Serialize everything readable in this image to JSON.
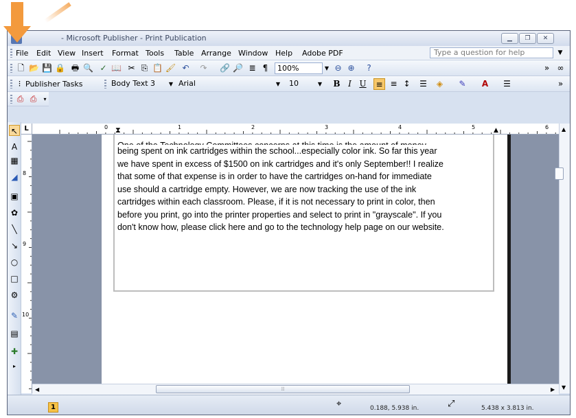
{
  "window": {
    "title": "- Microsoft Publisher - Print Publication",
    "controls": [
      "minimize",
      "restore",
      "close"
    ]
  },
  "menubar": {
    "items": [
      {
        "label": "File"
      },
      {
        "label": "Edit"
      },
      {
        "label": "View"
      },
      {
        "label": "Insert"
      },
      {
        "label": "Format"
      },
      {
        "label": "Tools"
      },
      {
        "label": "Table"
      },
      {
        "label": "Arrange"
      },
      {
        "label": "Window"
      },
      {
        "label": "Help"
      },
      {
        "label": "Adobe PDF"
      }
    ],
    "ask_placeholder": "Type a question for help"
  },
  "standard_toolbar": {
    "zoom": "100%",
    "icons": [
      "new-icon",
      "open-icon",
      "save-icon",
      "permission-icon",
      "print-icon",
      "print-preview-icon",
      "spelling-icon",
      "research-icon",
      "cut-icon",
      "copy-icon",
      "paste-icon",
      "format-painter-icon",
      "undo-icon",
      "redo-icon",
      "hyperlink-icon",
      "show-boundaries-icon",
      "columns-icon",
      "paragraph-marks-icon",
      "zoom-out-icon",
      "zoom-in-icon",
      "help-icon"
    ]
  },
  "formatting_toolbar": {
    "publisher_tasks": "Publisher Tasks",
    "style": "Body Text 3",
    "font": "Arial",
    "size": "10",
    "bold": "B",
    "italic": "I",
    "underline": "U"
  },
  "ruler": {
    "corner": "L",
    "h_numbers": [
      "0",
      "1",
      "2",
      "3",
      "4",
      "5",
      "6"
    ],
    "v_numbers": [
      "8",
      "9",
      "10"
    ]
  },
  "document": {
    "lines": [
      "One of the Technology Committees concerns at this time is the amount of money",
      "being spent on ink cartridges within the school...especially color ink. So far this year",
      "we have spent in excess of $1500 on ink cartridges and it's only September!! I realize",
      "that some of that expense is in order to have the cartridges on-hand for immediate",
      "use should a cartridge empty. However, we are now tracking the use of the ink",
      "cartridges within each classroom. Please, if it is not necessary to print in color, then",
      "before you print, go into the printer properties and select to print in \"grayscale\".  If you",
      "don't know how, please click here and go to the technology help page on our website."
    ]
  },
  "statusbar": {
    "page": "1",
    "position": "0.188, 5.938 in.",
    "size": "5.438 x 3.813 in."
  },
  "colors": {
    "pointer_arrow": "#f39a3d",
    "workspace": "#8893a8",
    "chrome": "#dce5f2"
  }
}
